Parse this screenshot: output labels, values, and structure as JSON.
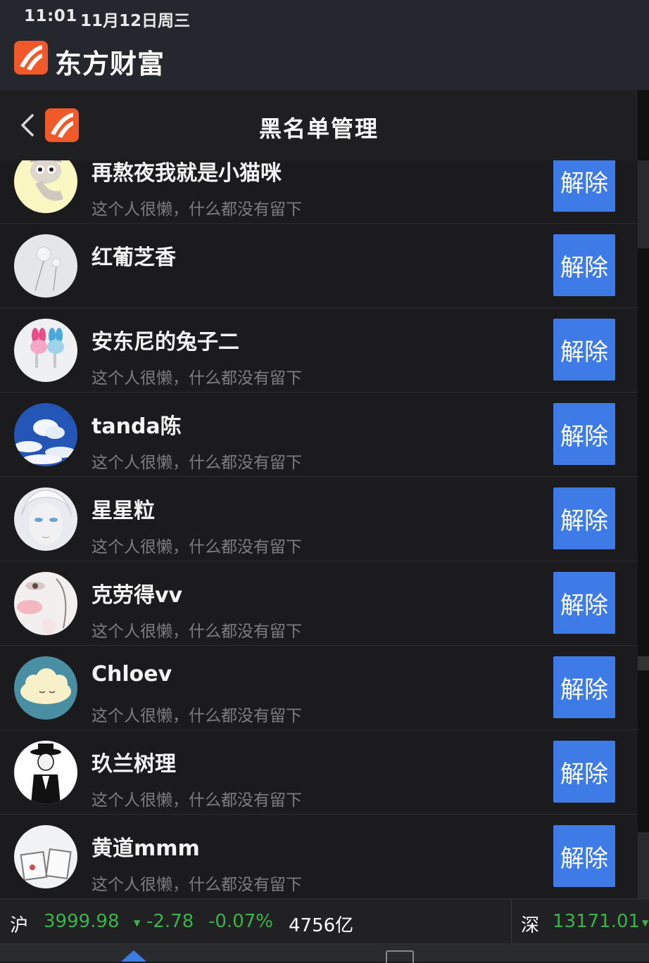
{
  "status_bar": {
    "time": "11:01",
    "date": "11月12日周三"
  },
  "app_header": {
    "brand": "东方财富"
  },
  "nav": {
    "title": "黑名单管理"
  },
  "colors": {
    "accent": "#3f7be6",
    "brand": "#f1582a",
    "up_down_green": "#3bb34a"
  },
  "list": {
    "items": [
      {
        "name": "再熬夜我就是小猫咪",
        "signature": "这个人很懒，什么都没有留下",
        "button": "解除",
        "avatar": "cartoon-cat-avatar"
      },
      {
        "name": "红葡芝香",
        "signature": "",
        "button": "解除",
        "avatar": "dandelion-avatar"
      },
      {
        "name": "安东尼的兔子二",
        "signature": "这个人很懒，什么都没有留下",
        "button": "解除",
        "avatar": "bunny-clips-avatar"
      },
      {
        "name": "tanda陈",
        "signature": "这个人很懒，什么都没有留下",
        "button": "解除",
        "avatar": "sky-clouds-avatar"
      },
      {
        "name": "星星粒",
        "signature": "这个人很懒，什么都没有留下",
        "button": "解除",
        "avatar": "anime-face-avatar"
      },
      {
        "name": "克劳得vv",
        "signature": "这个人很懒，什么都没有留下",
        "button": "解除",
        "avatar": "makeup-face-avatar"
      },
      {
        "name": "Chloev",
        "signature": "这个人很懒，什么都没有留下",
        "button": "解除",
        "avatar": "cloud-cartoon-avatar"
      },
      {
        "name": "玖兰树理",
        "signature": "这个人很懒，什么都没有留下",
        "button": "解除",
        "avatar": "hat-figure-avatar"
      },
      {
        "name": "黄道mmm",
        "signature": "这个人很懒，什么都没有留下",
        "button": "解除",
        "avatar": "photo-frames-avatar"
      }
    ]
  },
  "ticker": {
    "sh_label": "沪",
    "sh_index": "3999.98",
    "sh_change": "-2.78",
    "sh_pct": "-0.07%",
    "sh_volume": "4756亿",
    "sz_label": "深",
    "sz_index": "13171.01"
  }
}
